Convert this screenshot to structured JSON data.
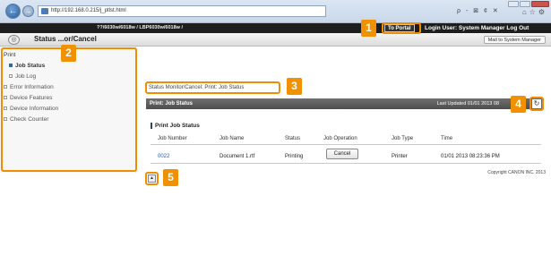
{
  "browser": {
    "address": "http://192.168.0.215/j_ptlst.html",
    "search_glyph": "ρ",
    "tools_glyphs": "ρ - ⊠ ¢ ✕"
  },
  "app": {
    "model": "??/6030w/6018w / LBP6030w/6018w /",
    "portal_label": "To Portal",
    "login_text": "Login User: System Manager Log Out",
    "page_title": "Status ...or/Cancel",
    "mail_label": "Mail to System Manager"
  },
  "sidebar": {
    "head": "Print",
    "items": [
      {
        "label": "Job Status",
        "active": true
      },
      {
        "label": "Job Log",
        "active": false
      },
      {
        "label": "Error Information",
        "active": false
      },
      {
        "label": "Device Features",
        "active": false
      },
      {
        "label": "Device Information",
        "active": false
      },
      {
        "label": "Check Counter",
        "active": false
      }
    ]
  },
  "main": {
    "breadcrumb": "Status Monitor/Cancel: Print: Job Status",
    "panel_title": "Print: Job Status",
    "last_updated": "Last Updated 01/01 2013 08",
    "section_title": "Print Job Status",
    "columns": [
      "Job Number",
      "Job Name",
      "Status",
      "Job Operation",
      "Job Type",
      "Time"
    ],
    "row": {
      "job_number": "0022",
      "job_name": "Document 1.rtf",
      "status": "Printing",
      "operation": "Cancel",
      "job_type": "Printer",
      "time": "01/01 2013 08:23:36 PM"
    },
    "copyright": "Copyright CANON INC. 2013"
  },
  "callouts": [
    "1",
    "2",
    "3",
    "4",
    "5"
  ],
  "colors": {
    "callout": "#f29100",
    "header_dark": "#1e1e1e",
    "panel_head": "#555555"
  }
}
